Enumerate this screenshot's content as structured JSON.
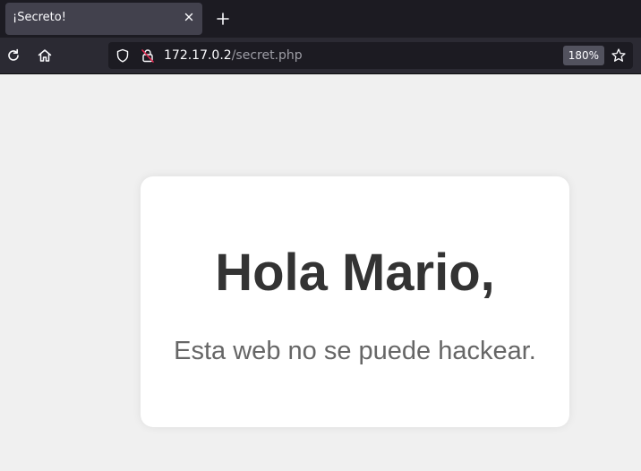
{
  "browser": {
    "tab": {
      "title": "¡Secreto!",
      "close_icon": "close-icon"
    },
    "new_tab_icon": "plus-icon",
    "toolbar": {
      "reload_icon": "reload-icon",
      "home_icon": "home-icon",
      "shield_icon": "shield-icon",
      "lock_icon": "insecure-lock-icon",
      "url_host": "172.17.0.2",
      "url_path": "/secret.php",
      "zoom": "180%",
      "bookmark_icon": "star-icon"
    },
    "colors": {
      "tabbar_bg": "#1c1b22",
      "toolbar_bg": "#2b2a33",
      "active_tab_bg": "#42414d",
      "insecure_lock": "#e22850"
    }
  },
  "page": {
    "heading": "Hola Mario,",
    "message": "Esta web no se puede hackear.",
    "colors": {
      "background": "#f0f0f0",
      "card": "#ffffff",
      "heading": "#333333",
      "message": "#666666"
    }
  }
}
